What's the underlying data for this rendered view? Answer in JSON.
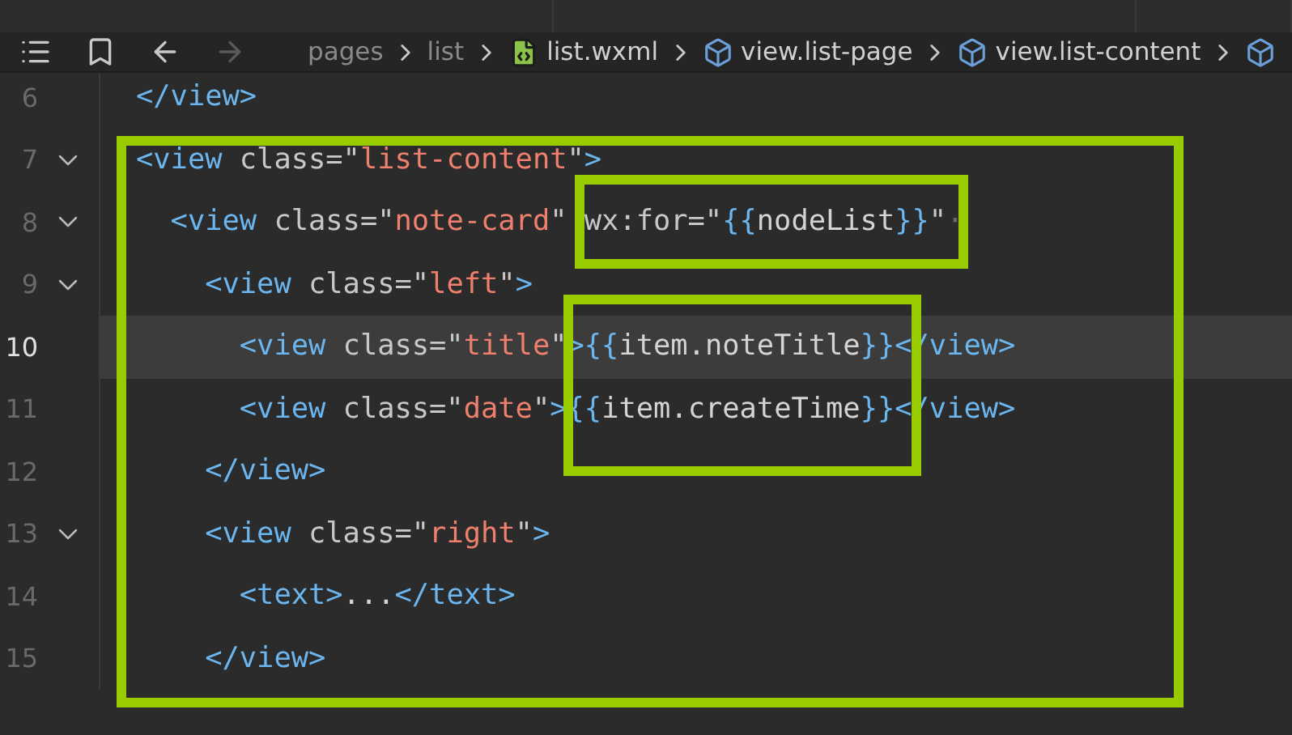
{
  "toolbar": {
    "buttons": [
      {
        "kind": "outline",
        "disabled": false
      },
      {
        "kind": "bookmark",
        "disabled": false
      },
      {
        "kind": "back",
        "disabled": false
      },
      {
        "kind": "forward",
        "disabled": true
      }
    ]
  },
  "breadcrumb": [
    {
      "kind": "folder",
      "label": "pages"
    },
    {
      "kind": "folder",
      "label": "list"
    },
    {
      "kind": "file",
      "label": "list.wxml"
    },
    {
      "kind": "element",
      "label": "view.list-page"
    },
    {
      "kind": "element",
      "label": "view.list-content"
    },
    {
      "kind": "element"
    }
  ],
  "editor": {
    "lines": [
      {
        "number": "6",
        "foldable": false,
        "current": false,
        "tokens": [
          {
            "kind": "tag",
            "text": "</view>"
          }
        ]
      },
      {
        "number": "7",
        "foldable": true,
        "current": false,
        "tokens": [
          {
            "kind": "tag",
            "text": "<view"
          },
          {
            "kind": "attr",
            "text": " class=\""
          },
          {
            "kind": "string",
            "text": "list-content"
          },
          {
            "kind": "attr",
            "text": "\""
          },
          {
            "kind": "tag",
            "text": ">"
          }
        ]
      },
      {
        "number": "8",
        "foldable": true,
        "current": false,
        "tokens": [
          {
            "kind": "tag",
            "text": "  <view"
          },
          {
            "kind": "attr",
            "text": " class=\""
          },
          {
            "kind": "string",
            "text": "note-card"
          },
          {
            "kind": "attr",
            "text": "\" wx:for=\""
          },
          {
            "kind": "brace",
            "text": "{{"
          },
          {
            "kind": "text",
            "text": "nodeList"
          },
          {
            "kind": "brace",
            "text": "}}"
          },
          {
            "kind": "attr",
            "text": "\""
          },
          {
            "kind": "whitespace",
            "text": "·"
          }
        ]
      },
      {
        "number": "9",
        "foldable": true,
        "current": false,
        "tokens": [
          {
            "kind": "tag",
            "text": "    <view"
          },
          {
            "kind": "attr",
            "text": " class=\""
          },
          {
            "kind": "string",
            "text": "left"
          },
          {
            "kind": "attr",
            "text": "\""
          },
          {
            "kind": "tag",
            "text": ">"
          }
        ]
      },
      {
        "number": "10",
        "foldable": false,
        "current": true,
        "tokens": [
          {
            "kind": "tag",
            "text": "      <view"
          },
          {
            "kind": "attr",
            "text": " class=\""
          },
          {
            "kind": "string",
            "text": "title"
          },
          {
            "kind": "attr",
            "text": "\""
          },
          {
            "kind": "tag",
            "text": ">"
          },
          {
            "kind": "brace",
            "text": "{{"
          },
          {
            "kind": "text",
            "text": "item.noteTitle"
          },
          {
            "kind": "brace",
            "text": "}}"
          },
          {
            "kind": "tag",
            "text": "</view>"
          }
        ]
      },
      {
        "number": "11",
        "foldable": false,
        "current": false,
        "tokens": [
          {
            "kind": "tag",
            "text": "      <view"
          },
          {
            "kind": "attr",
            "text": " class=\""
          },
          {
            "kind": "string",
            "text": "date"
          },
          {
            "kind": "attr",
            "text": "\""
          },
          {
            "kind": "tag",
            "text": ">"
          },
          {
            "kind": "brace",
            "text": "{{"
          },
          {
            "kind": "text",
            "text": "item.createTime"
          },
          {
            "kind": "brace",
            "text": "}}"
          },
          {
            "kind": "tag",
            "text": "</view>"
          }
        ]
      },
      {
        "number": "12",
        "foldable": false,
        "current": false,
        "tokens": [
          {
            "kind": "tag",
            "text": "    </view>"
          }
        ]
      },
      {
        "number": "13",
        "foldable": true,
        "current": false,
        "tokens": [
          {
            "kind": "tag",
            "text": "    <view"
          },
          {
            "kind": "attr",
            "text": " class=\""
          },
          {
            "kind": "string",
            "text": "right"
          },
          {
            "kind": "attr",
            "text": "\""
          },
          {
            "kind": "tag",
            "text": ">"
          }
        ]
      },
      {
        "number": "14",
        "foldable": false,
        "current": false,
        "tokens": [
          {
            "kind": "tag",
            "text": "      <text>"
          },
          {
            "kind": "text",
            "text": "..."
          },
          {
            "kind": "tag",
            "text": "</text>"
          }
        ]
      },
      {
        "number": "15",
        "foldable": false,
        "current": false,
        "tokens": [
          {
            "kind": "tag",
            "text": "    </view>"
          }
        ]
      }
    ]
  }
}
